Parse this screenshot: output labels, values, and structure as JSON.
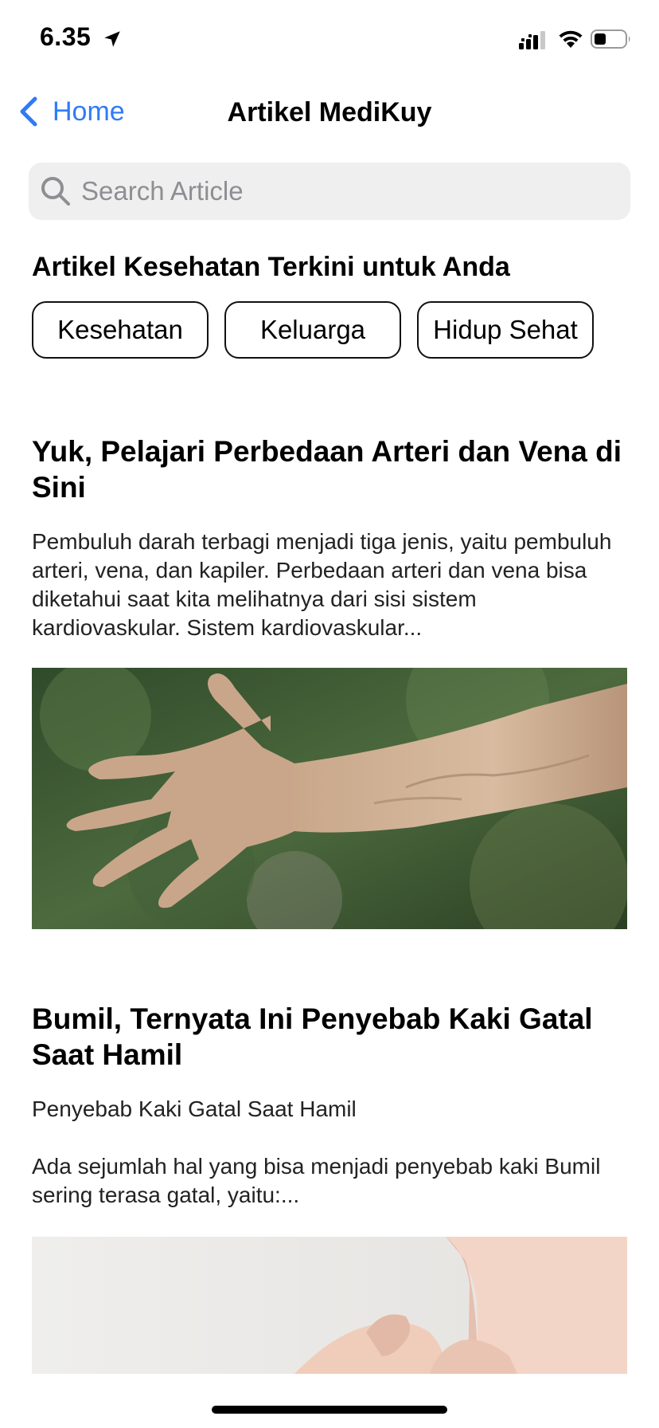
{
  "status_bar": {
    "time": "6.35",
    "icons": [
      "location-arrow-icon",
      "signal-icon",
      "wifi-icon",
      "battery-icon"
    ]
  },
  "nav": {
    "back_label": "Home",
    "title": "Artikel MediKuy",
    "accent_color": "#2f7bf6"
  },
  "search": {
    "placeholder": "Search Article",
    "value": ""
  },
  "section": {
    "heading": "Artikel Kesehatan Terkini untuk Anda",
    "categories": [
      "Kesehatan",
      "Keluarga",
      "Hidup Sehat"
    ]
  },
  "articles": [
    {
      "title": "Yuk, Pelajari Perbedaan Arteri dan Vena di Sini",
      "excerpt": "Pembuluh darah terbagi menjadi tiga jenis, yaitu pembuluh arteri, vena, dan kapiler. Perbedaan arteri dan vena bisa diketahui saat kita melihatnya dari sisi sistem kardiovaskular. Sistem kardiovaskular..."
    },
    {
      "title": "Bumil, Ternyata Ini Penyebab Kaki Gatal Saat Hamil",
      "subtitle": "Penyebab Kaki Gatal Saat Hamil",
      "excerpt": "Ada sejumlah hal yang bisa menjadi penyebab kaki Bumil sering terasa gatal, yaitu:..."
    }
  ]
}
